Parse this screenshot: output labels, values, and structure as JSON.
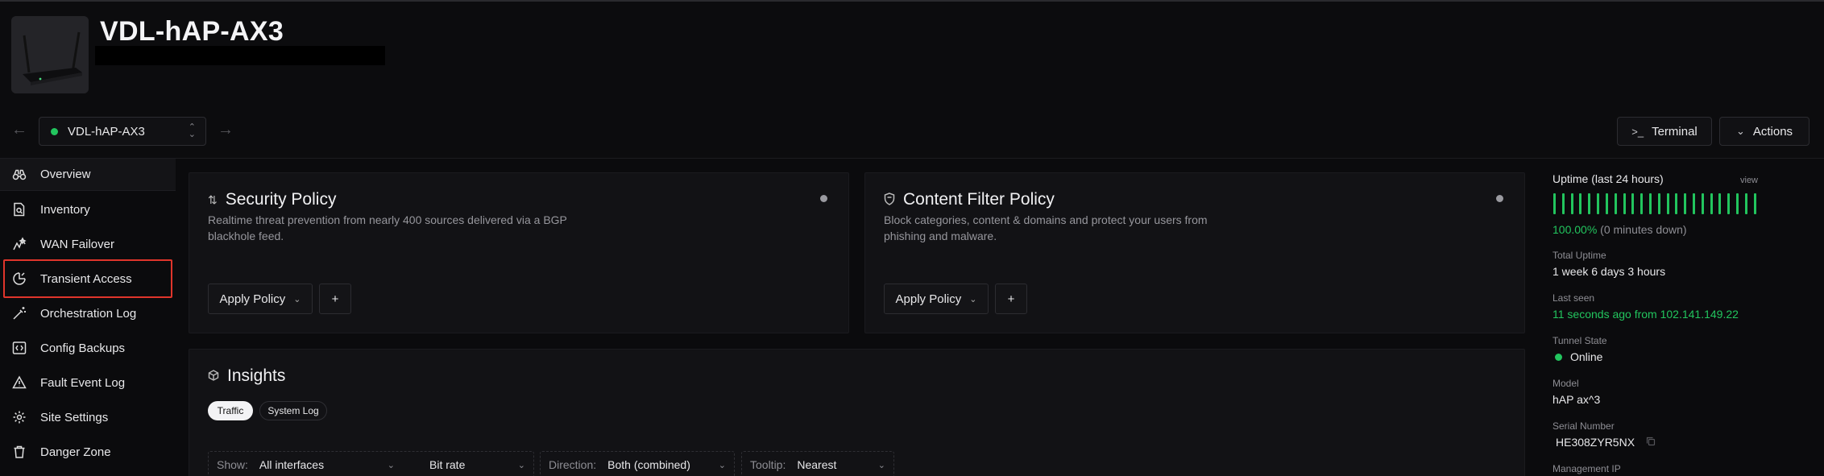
{
  "device": {
    "name": "VDL-hAP-AX3"
  },
  "nav": {
    "selector_value": "VDL-hAP-AX3",
    "terminal_label": "Terminal",
    "actions_label": "Actions"
  },
  "sidebar": {
    "items": [
      {
        "label": "Overview",
        "icon": "binoculars-icon"
      },
      {
        "label": "Inventory",
        "icon": "document-search-icon"
      },
      {
        "label": "WAN Failover",
        "icon": "spark-icon"
      },
      {
        "label": "Transient Access",
        "icon": "clock-pie-icon"
      },
      {
        "label": "Orchestration Log",
        "icon": "magic-wand-icon"
      },
      {
        "label": "Config Backups",
        "icon": "code-bracket-icon"
      },
      {
        "label": "Fault Event Log",
        "icon": "warning-icon"
      },
      {
        "label": "Site Settings",
        "icon": "gear-icon"
      },
      {
        "label": "Danger Zone",
        "icon": "trash-icon"
      }
    ]
  },
  "security_policy": {
    "title": "Security Policy",
    "description_line1": "Realtime threat prevention from nearly 400 sources delivered via a BGP",
    "description_line2": "blackhole feed.",
    "apply_label": "Apply Policy",
    "add_label": "+"
  },
  "content_filter": {
    "title": "Content Filter Policy",
    "description_line1": "Block categories, content & domains and protect your users from",
    "description_line2": "phishing and malware.",
    "apply_label": "Apply Policy",
    "add_label": "+"
  },
  "insights": {
    "title": "Insights",
    "tabs": [
      "Traffic",
      "System Log"
    ],
    "filters": {
      "show_label": "Show:",
      "show_value": "All interfaces",
      "rate_value": "Bit rate",
      "direction_label": "Direction:",
      "direction_value": "Both (combined)",
      "tooltip_label": "Tooltip:",
      "tooltip_value": "Nearest"
    }
  },
  "status": {
    "uptime_label": "Uptime (last 24 hours)",
    "view_label": "view",
    "uptime_percent": "100.00%",
    "uptime_down": "(0 minutes down)",
    "total_uptime_label": "Total Uptime",
    "total_uptime_value": "1 week 6 days 3 hours",
    "last_seen_label": "Last seen",
    "last_seen_value": "11 seconds ago from 102.141.149.22",
    "tunnel_label": "Tunnel State",
    "tunnel_value": "Online",
    "model_label": "Model",
    "model_value": "hAP ax^3",
    "serial_label": "Serial Number",
    "serial_value": "HE308ZYR5NX",
    "mgmt_ip_label": "Management IP"
  },
  "colors": {
    "accent_green": "#22c55e",
    "highlight_red": "#e0352b"
  }
}
